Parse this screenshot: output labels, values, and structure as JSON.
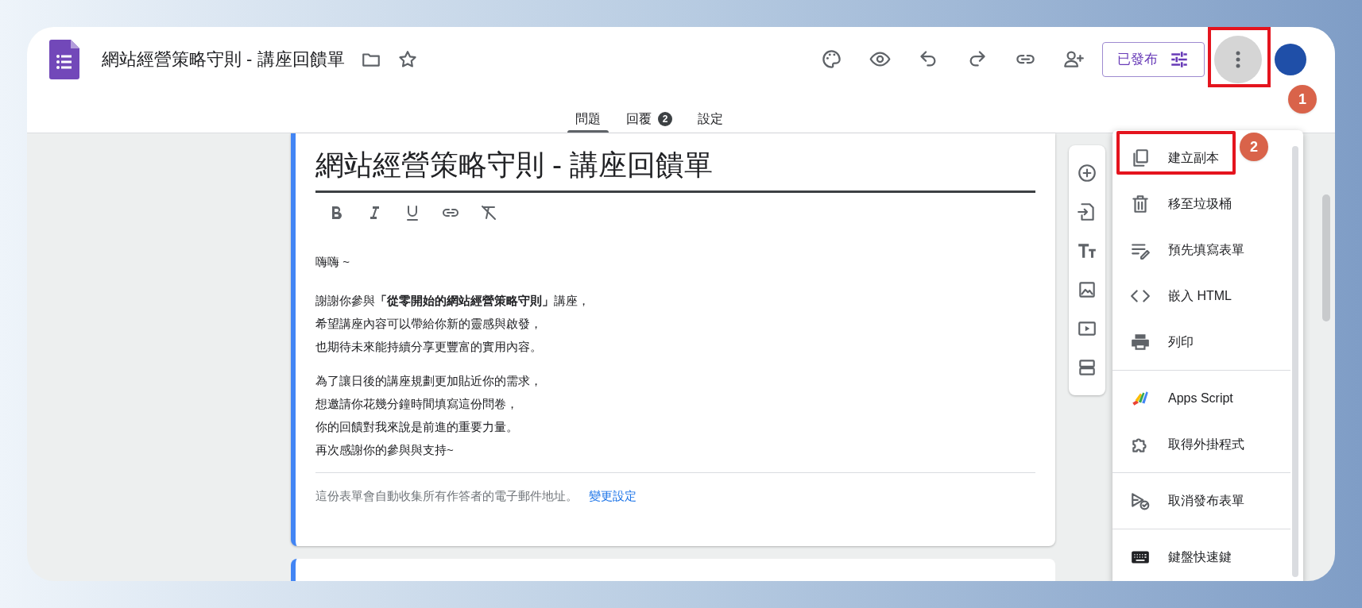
{
  "header": {
    "title": "網站經營策略守則 - 講座回饋單",
    "publish_button": "已發布",
    "more_button": {
      "highlighted": true
    }
  },
  "tabs": [
    {
      "label": "問題",
      "selected": true
    },
    {
      "label": "回覆",
      "selected": false,
      "count": "2"
    },
    {
      "label": "設定",
      "selected": false
    }
  ],
  "form": {
    "title": "網站經營策略守則 - 講座回饋單",
    "description": [
      [
        "嗨嗨 ~"
      ],
      [
        "謝謝你參與**「從零開始的網站經營策略守則」**講座，",
        "希望講座內容可以帶給你新的靈感與啟發，",
        "也期待未來能持續分享更豐富的實用內容。"
      ],
      [
        "為了讓日後的講座規劃更加貼近你的需求，",
        "想邀請你花幾分鐘時間填寫這份問卷，",
        "你的回饋對我來說是前進的重要力量。",
        "再次感謝你的參與與支持~"
      ]
    ],
    "email_notice": "這份表單會自動收集所有作答者的電子郵件地址。",
    "change_settings_link": "變更設定"
  },
  "more_menu": {
    "sections": [
      [
        {
          "label": "建立副本",
          "highlighted": true
        },
        {
          "label": "移至垃圾桶",
          "highlighted": false
        },
        {
          "label": "預先填寫表單",
          "highlighted": false
        },
        {
          "label": "嵌入 HTML",
          "highlighted": false
        },
        {
          "label": "列印",
          "highlighted": false
        }
      ],
      [
        {
          "label": "Apps Script",
          "highlighted": false
        },
        {
          "label": "取得外掛程式",
          "highlighted": false
        }
      ],
      [
        {
          "label": "取消發布表單",
          "highlighted": false
        }
      ],
      [
        {
          "label": "鍵盤快速鍵",
          "highlighted": false
        }
      ]
    ]
  },
  "annotations": [
    {
      "label": "1"
    },
    {
      "label": "2"
    }
  ]
}
